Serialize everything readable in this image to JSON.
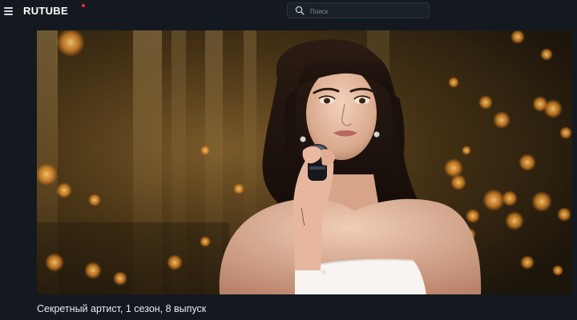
{
  "header": {
    "logo_text": "RUTUBE",
    "search_placeholder": "Поиск",
    "menu_icon": "hamburger-menu-icon",
    "search_icon": "search-icon"
  },
  "video": {
    "title": "Секретный артист, 1 сезон, 8 выпуск"
  },
  "colors": {
    "background": "#14191f",
    "logo_accent": "#ff1f4b",
    "search_bg": "#1b2129"
  }
}
